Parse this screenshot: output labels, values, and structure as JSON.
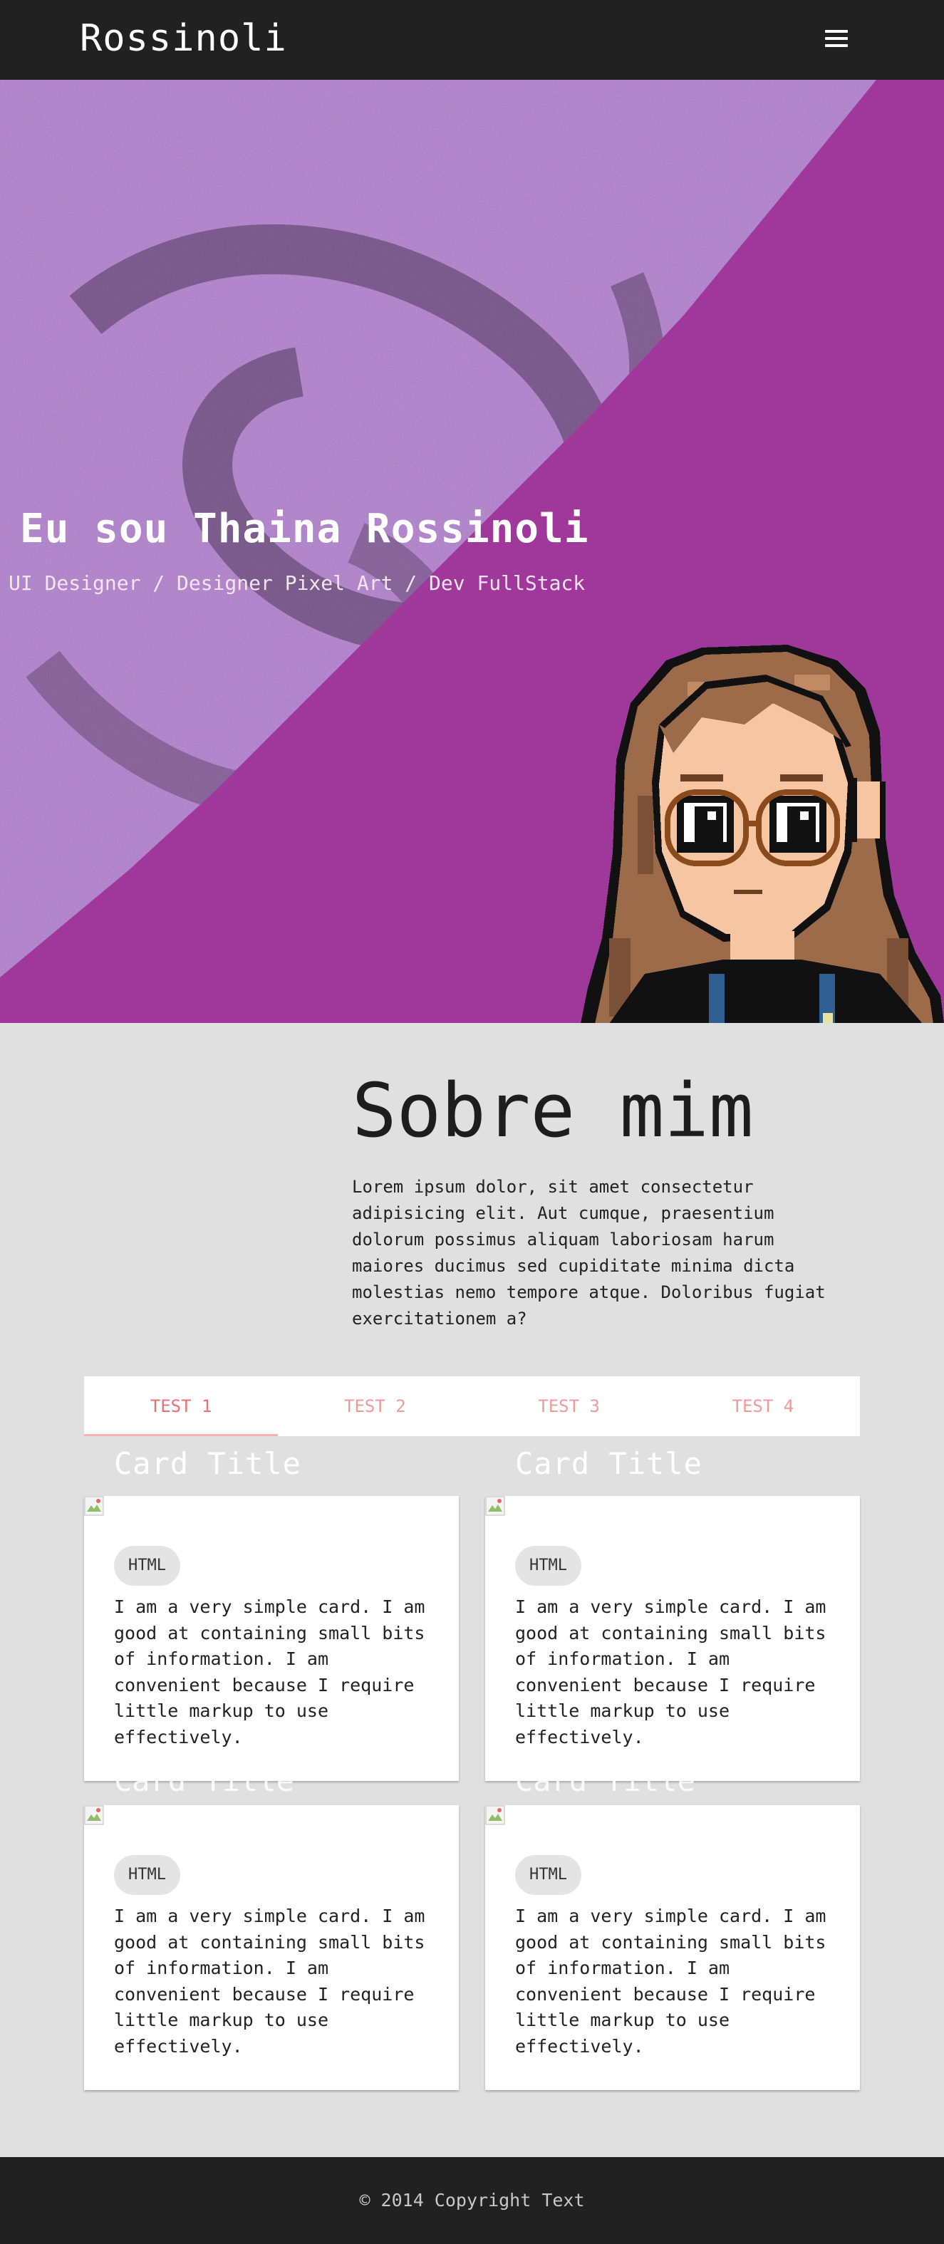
{
  "brand": "Rossinoli",
  "hero": {
    "title": "Eu sou Thaina Rossinoli",
    "subtitle": "UI Designer / Designer Pixel Art / Dev FullStack"
  },
  "about": {
    "title": "Sobre mim",
    "text": "Lorem ipsum dolor, sit amet consectetur adipisicing elit. Aut cumque, praesentium dolorum possimus aliquam laboriosam harum maiores ducimus sed cupiditate minima dicta molestias nemo tempore atque. Doloribus fugiat exercitationem a?"
  },
  "tabs": [
    {
      "label": "TEST 1",
      "active": true
    },
    {
      "label": "TEST 2",
      "active": false
    },
    {
      "label": "TEST 3",
      "active": false
    },
    {
      "label": "TEST 4",
      "active": false
    }
  ],
  "cards": [
    {
      "title": "Card Title",
      "chip": "HTML",
      "text": "I am a very simple card. I am good at containing small bits of information. I am convenient because I require little markup to use effectively."
    },
    {
      "title": "Card Title",
      "chip": "HTML",
      "text": "I am a very simple card. I am good at containing small bits of information. I am convenient because I require little markup to use effectively."
    },
    {
      "title": "Card Title",
      "chip": "HTML",
      "text": "I am a very simple card. I am good at containing small bits of information. I am convenient because I require little markup to use effectively."
    },
    {
      "title": "Card Title",
      "chip": "HTML",
      "text": "I am a very simple card. I am good at containing small bits of information. I am convenient because I require little markup to use effectively."
    }
  ],
  "footer": {
    "copyright": "© 2014 Copyright Text"
  },
  "colors": {
    "navbar": "#212121",
    "hero": "#a0379a",
    "accent": "#ee6e73",
    "background": "#e0e0e0"
  },
  "icons": {
    "menu": "hamburger-menu-icon",
    "card_image": "broken-image-icon"
  }
}
